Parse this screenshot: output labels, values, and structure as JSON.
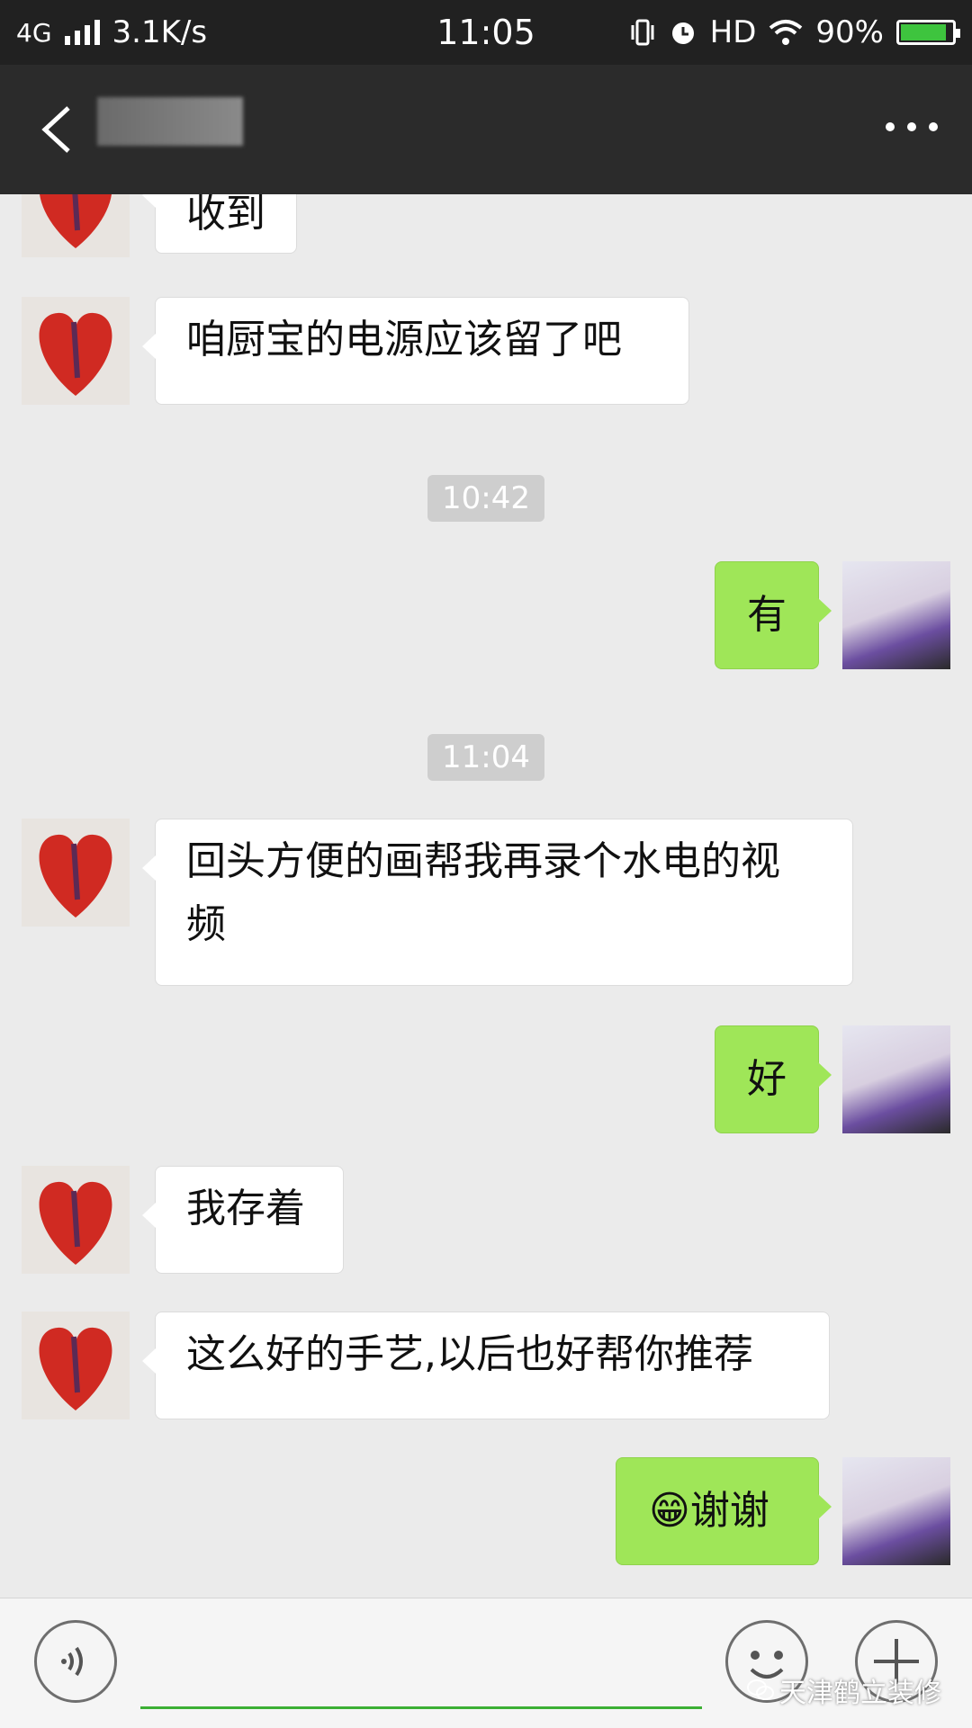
{
  "status_bar": {
    "network": "4G",
    "speed": "3.1K/s",
    "time": "11:05",
    "hd": "HD",
    "battery": "90%",
    "battery_level": 0.9
  },
  "header": {
    "title": ""
  },
  "messages": [
    {
      "side": "in",
      "text": "收到"
    },
    {
      "side": "in",
      "text": "咱厨宝的电源应该留了吧"
    },
    {
      "time": "10:42"
    },
    {
      "side": "out",
      "text": "有"
    },
    {
      "time": "11:04"
    },
    {
      "side": "in",
      "text_line1": "回头方便的画帮我再录个水电的视",
      "text_line2": "频"
    },
    {
      "side": "out",
      "text": "好"
    },
    {
      "side": "in",
      "text": "我存着"
    },
    {
      "side": "in",
      "text": "这么好的手艺,以后也好帮你推荐"
    },
    {
      "side": "out",
      "emoji": "😁",
      "text": "谢谢"
    }
  ],
  "watermark": "天津鹤立装修",
  "colors": {
    "outgoing_bubble": "#9fe658",
    "incoming_bubble": "#ffffff",
    "input_underline": "#3cb034"
  }
}
